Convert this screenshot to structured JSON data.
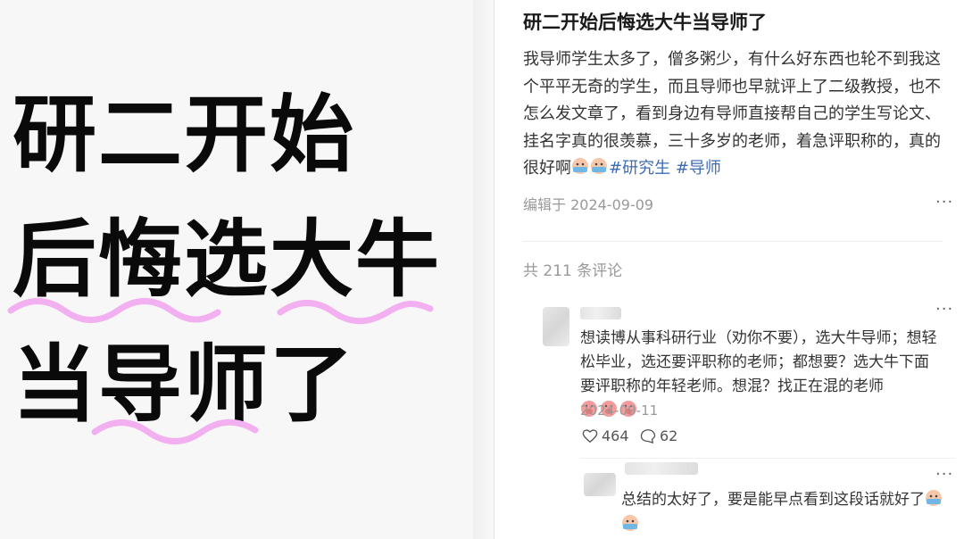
{
  "cover": {
    "line1": "研二开始",
    "line2": "后悔选大牛",
    "line3": "当导师了",
    "accent_color": "#f3b0f0"
  },
  "post": {
    "title": "研二开始后悔选大牛当导师了",
    "body": "我导师学生太多了，僧多粥少，有什么好东西也轮不到我这个平平无奇的学生，而且导师也早就评上了二级教授，也不怎么发文章了，看到身边有导师直接帮自己的学生写论文、挂名字真的很羡慕，三十多岁的老师，着急评职称的，真的很好啊",
    "tags": [
      "#研究生",
      "#导师"
    ],
    "edited": "编辑于 2024-09-09",
    "tag_color": "#3d6cb3"
  },
  "comments": {
    "count_label": "共 211 条评论",
    "first": {
      "text": "想读博从事科研行业（劝你不要），选大牛导师；想轻松毕业，选还要评职称的老师；都想要？选大牛下面要评职称的年轻老师。想混？找正在混的老师",
      "date": "2024-09-11",
      "likes": "464",
      "replies": "62"
    },
    "reply": {
      "text": "总结的太好了，要是能早点看到这段话就好了"
    }
  },
  "icons": {
    "more": "more-dots-icon",
    "like": "heart-icon",
    "comment": "comment-bubble-icon",
    "emoji_crying": "crying-face-emoji-icon",
    "emoji_pig": "pig-face-emoji-icon"
  }
}
